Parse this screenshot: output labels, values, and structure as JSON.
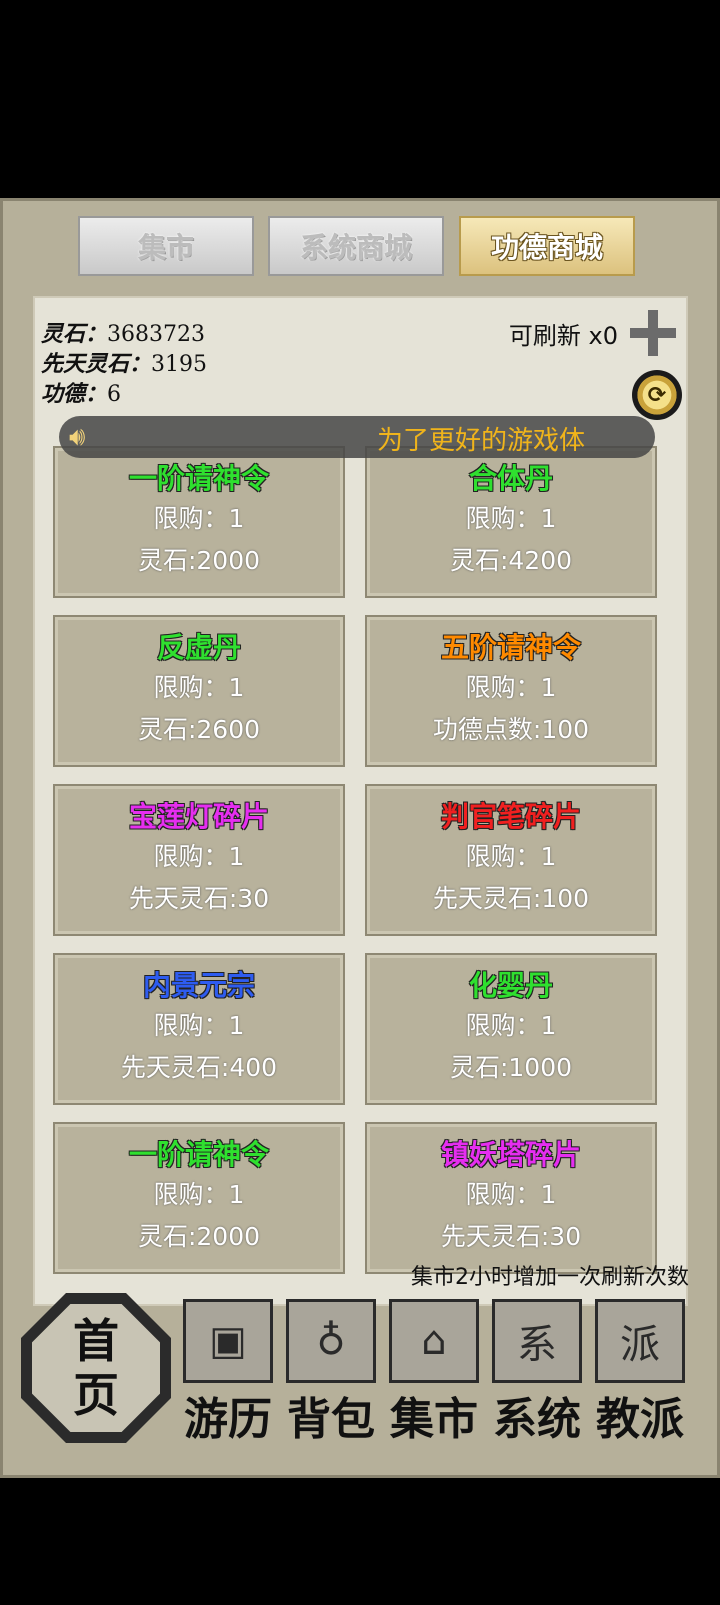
{
  "tabs": [
    {
      "label": "集市",
      "active": false
    },
    {
      "label": "系统商城",
      "active": false
    },
    {
      "label": "功德商城",
      "active": true
    }
  ],
  "resources": [
    {
      "label": "灵石：",
      "value": "3683723"
    },
    {
      "label": "先天灵石：",
      "value": "3195"
    },
    {
      "label": "功德：",
      "value": "6"
    }
  ],
  "refresh_label": "可刷新 x0",
  "notice_text": "为了更好的游戏体",
  "items": [
    {
      "name": "一阶请神令",
      "color": "#2fe02f",
      "limit": "限购：1",
      "price": "灵石:2000"
    },
    {
      "name": "合体丹",
      "color": "#2fe02f",
      "limit": "限购：1",
      "price": "灵石:4200"
    },
    {
      "name": "反虚丹",
      "color": "#2fe02f",
      "limit": "限购：1",
      "price": "灵石:2600"
    },
    {
      "name": "五阶请神令",
      "color": "#ff8a00",
      "limit": "限购：1",
      "price": "功德点数:100"
    },
    {
      "name": "宝莲灯碎片",
      "color": "#e62ef0",
      "limit": "限购：1",
      "price": "先天灵石:30"
    },
    {
      "name": "判官笔碎片",
      "color": "#f02020",
      "limit": "限购：1",
      "price": "先天灵石:100"
    },
    {
      "name": "内景元宗",
      "color": "#2e5cf0",
      "limit": "限购：1",
      "price": "先天灵石:400"
    },
    {
      "name": "化婴丹",
      "color": "#2fe02f",
      "limit": "限购：1",
      "price": "灵石:1000"
    },
    {
      "name": "一阶请神令",
      "color": "#2fe02f",
      "limit": "限购：1",
      "price": "灵石:2000"
    },
    {
      "name": "镇妖塔碎片",
      "color": "#e62ef0",
      "limit": "限购：1",
      "price": "先天灵石:30"
    }
  ],
  "hint_text": "集市2小时增加一次刷新次数",
  "home_label": [
    "首",
    "页"
  ],
  "nav": [
    {
      "label": "游历",
      "icon": "chest-icon",
      "glyph": "▣"
    },
    {
      "label": "背包",
      "icon": "bag-icon",
      "glyph": "♁"
    },
    {
      "label": "集市",
      "icon": "stall-icon",
      "glyph": "⌂"
    },
    {
      "label": "系统",
      "icon": "system-seal-icon",
      "glyph": "系"
    },
    {
      "label": "教派",
      "icon": "sect-scroll-icon",
      "glyph": "派"
    }
  ]
}
